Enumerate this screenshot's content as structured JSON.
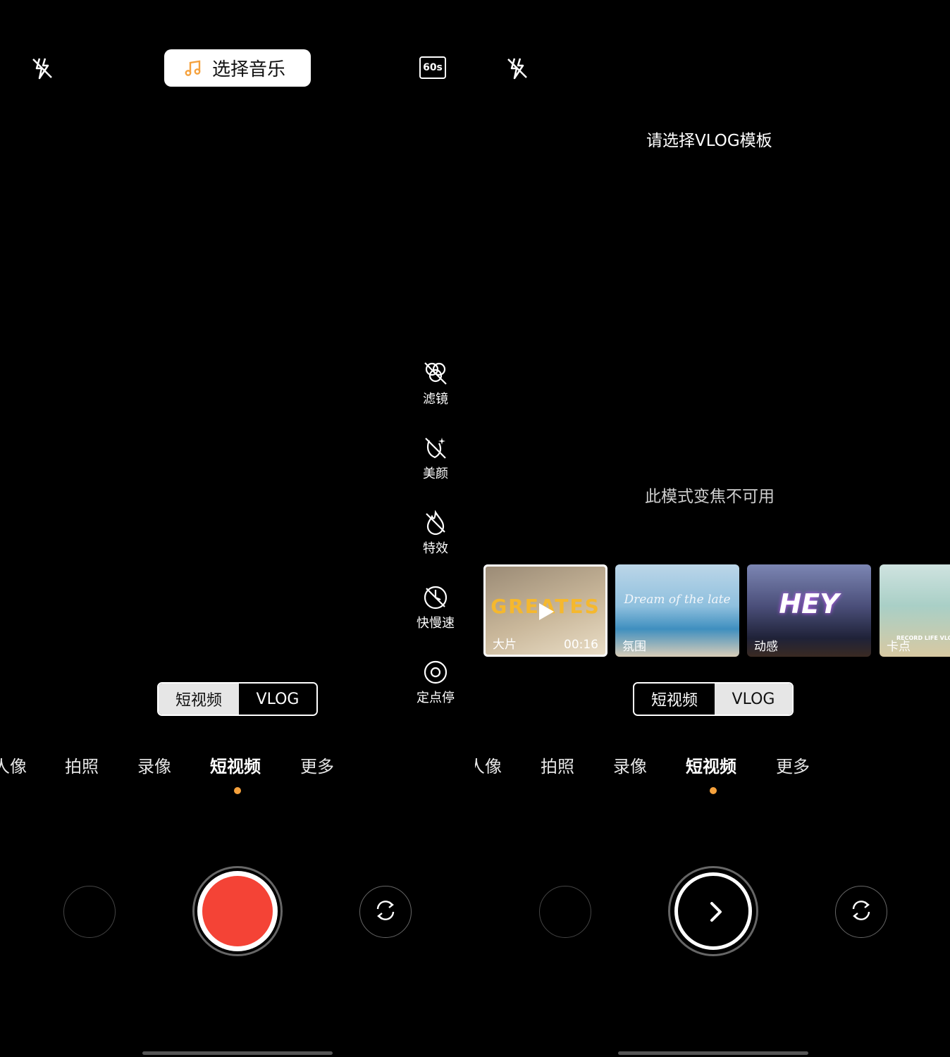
{
  "left": {
    "music_button": "选择音乐",
    "timer_label": "60s",
    "tools": [
      {
        "label": "滤镜",
        "icon": "filter-icon"
      },
      {
        "label": "美颜",
        "icon": "beauty-icon"
      },
      {
        "label": "特效",
        "icon": "effects-icon"
      },
      {
        "label": "快慢速",
        "icon": "speed-icon"
      },
      {
        "label": "定点停",
        "icon": "stop-point-icon"
      }
    ],
    "segment": {
      "short_video": "短视频",
      "vlog": "VLOG",
      "selected": "短视频"
    },
    "modes": [
      "人像",
      "拍照",
      "录像",
      "短视频",
      "更多"
    ],
    "active_mode": "短视频"
  },
  "right": {
    "template_prompt": "请选择VLOG模板",
    "zoom_notice": "此模式变焦不可用",
    "templates": [
      {
        "label": "大片",
        "duration": "00:16",
        "title": "GREATES",
        "selected": true
      },
      {
        "label": "氛围",
        "title": "Dream of the late"
      },
      {
        "label": "动感",
        "title": "HEY"
      },
      {
        "label": "卡点",
        "title": "RECORD LIFE VLOG"
      }
    ],
    "segment": {
      "short_video": "短视频",
      "vlog": "VLOG",
      "selected": "VLOG"
    },
    "modes": [
      "人像",
      "拍照",
      "录像",
      "短视频",
      "更多"
    ],
    "active_mode": "短视频"
  },
  "colors": {
    "accent": "#f5a13c",
    "record": "#f44336",
    "background": "#000000"
  }
}
